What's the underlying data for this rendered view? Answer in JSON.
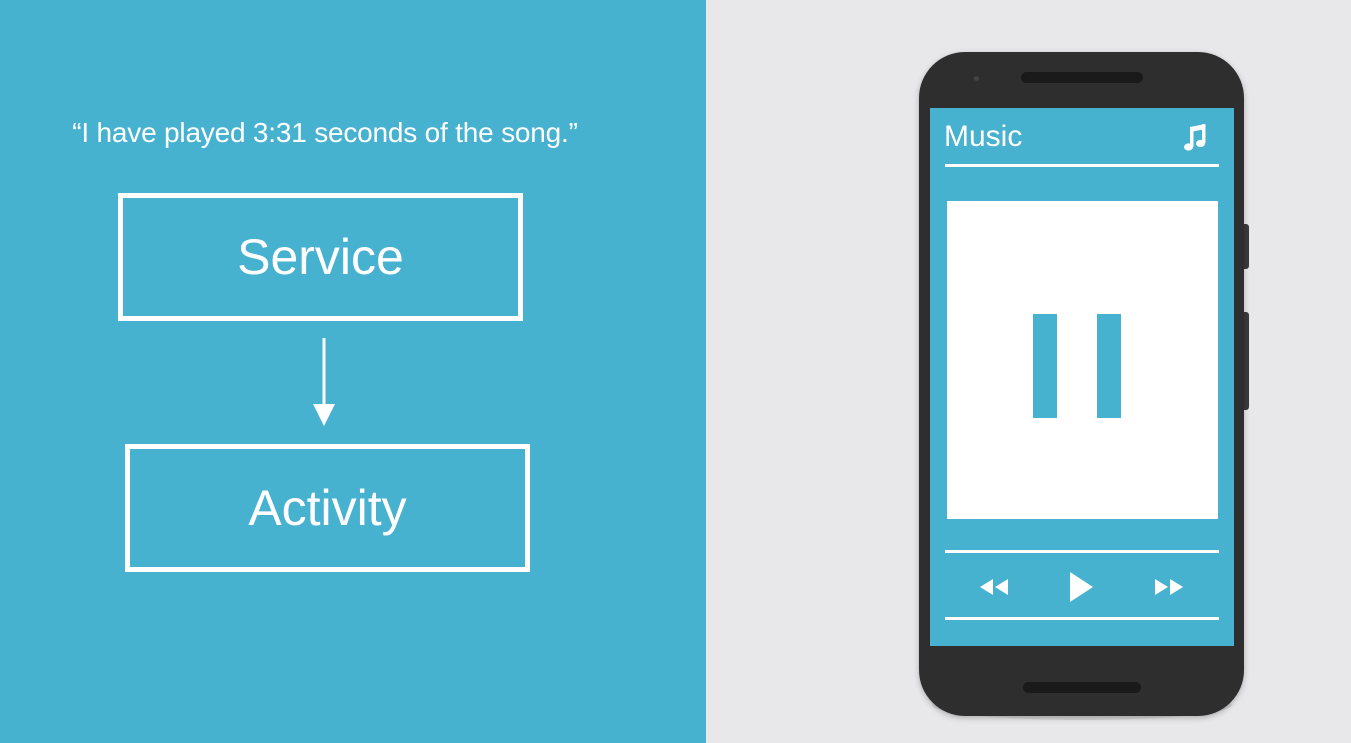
{
  "diagram": {
    "quote": "“I have played 3:31 seconds of the song.”",
    "nodes": [
      {
        "id": "service",
        "label": "Service"
      },
      {
        "id": "activity",
        "label": "Activity"
      }
    ],
    "edges": [
      {
        "from": "service",
        "to": "activity"
      }
    ]
  },
  "phone": {
    "app_title": "Music",
    "icons": {
      "header": "music-note-icon",
      "artwork_state": "pause-icon",
      "controls": [
        "rewind-icon",
        "play-icon",
        "fast-forward-icon"
      ]
    }
  },
  "colors": {
    "accent": "#47b1d0",
    "background": "#e8e7e9",
    "phone_body": "#2e2e2e",
    "foreground": "#ffffff"
  }
}
